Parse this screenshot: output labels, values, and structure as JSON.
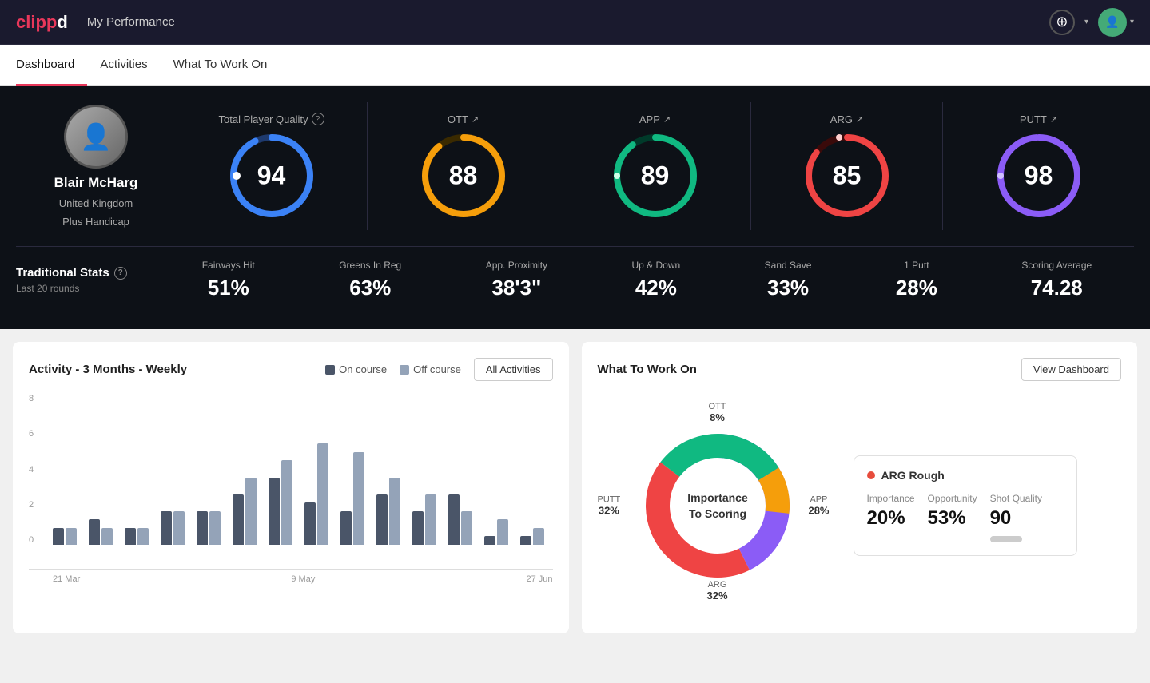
{
  "header": {
    "logo": "clippd",
    "title": "My Performance",
    "add_button_label": "+",
    "avatar_chevron": "▾"
  },
  "tabs": [
    {
      "id": "dashboard",
      "label": "Dashboard",
      "active": true
    },
    {
      "id": "activities",
      "label": "Activities",
      "active": false
    },
    {
      "id": "what-to-work-on",
      "label": "What To Work On",
      "active": false
    }
  ],
  "player": {
    "name": "Blair McHarg",
    "country": "United Kingdom",
    "handicap": "Plus Handicap"
  },
  "total_quality": {
    "label": "Total Player Quality",
    "score": 94,
    "color": "#3b82f6",
    "track_color": "#1e3a6e"
  },
  "category_scores": [
    {
      "id": "ott",
      "label": "OTT",
      "score": 88,
      "color": "#f59e0b",
      "track_color": "#3a2a00"
    },
    {
      "id": "app",
      "label": "APP",
      "score": 89,
      "color": "#10b981",
      "track_color": "#003a2a"
    },
    {
      "id": "arg",
      "label": "ARG",
      "score": 85,
      "color": "#ef4444",
      "track_color": "#3a0a0a"
    },
    {
      "id": "putt",
      "label": "PUTT",
      "score": 98,
      "color": "#8b5cf6",
      "track_color": "#1a0a3a"
    }
  ],
  "traditional_stats": {
    "title": "Traditional Stats",
    "subtitle": "Last 20 rounds",
    "items": [
      {
        "name": "Fairways Hit",
        "value": "51%"
      },
      {
        "name": "Greens In Reg",
        "value": "63%"
      },
      {
        "name": "App. Proximity",
        "value": "38'3\""
      },
      {
        "name": "Up & Down",
        "value": "42%"
      },
      {
        "name": "Sand Save",
        "value": "33%"
      },
      {
        "name": "1 Putt",
        "value": "28%"
      },
      {
        "name": "Scoring Average",
        "value": "74.28"
      }
    ]
  },
  "activity_chart": {
    "title": "Activity - 3 Months - Weekly",
    "legend": [
      {
        "label": "On course",
        "color": "#4a5568"
      },
      {
        "label": "Off course",
        "color": "#94a3b8"
      }
    ],
    "all_activities_btn": "All Activities",
    "y_labels": [
      "0",
      "2",
      "4",
      "6",
      "8"
    ],
    "x_labels": [
      "21 Mar",
      "9 May",
      "27 Jun"
    ],
    "bars": [
      {
        "on": 1,
        "off": 1
      },
      {
        "on": 1.5,
        "off": 1
      },
      {
        "on": 1,
        "off": 1
      },
      {
        "on": 2,
        "off": 2
      },
      {
        "on": 2,
        "off": 2
      },
      {
        "on": 3,
        "off": 4
      },
      {
        "on": 4,
        "off": 5
      },
      {
        "on": 2.5,
        "off": 6
      },
      {
        "on": 2,
        "off": 5.5
      },
      {
        "on": 3,
        "off": 4
      },
      {
        "on": 2,
        "off": 3
      },
      {
        "on": 3,
        "off": 2
      },
      {
        "on": 0.5,
        "off": 1.5
      },
      {
        "on": 0.5,
        "off": 1
      }
    ],
    "max_val": 9
  },
  "what_to_work_on": {
    "title": "What To Work On",
    "view_dashboard_btn": "View Dashboard",
    "center_label_line1": "Importance",
    "center_label_line2": "To Scoring",
    "segments": [
      {
        "id": "ott",
        "label": "OTT",
        "pct": "8%",
        "color": "#f59e0b"
      },
      {
        "id": "app",
        "label": "APP",
        "pct": "28%",
        "color": "#10b981"
      },
      {
        "id": "arg",
        "label": "ARG",
        "pct": "32%",
        "color": "#ef4444"
      },
      {
        "id": "putt",
        "label": "PUTT",
        "pct": "32%",
        "color": "#8b5cf6"
      }
    ],
    "info_card": {
      "title": "ARG Rough",
      "dot_color": "#e74c3c",
      "stats": [
        {
          "label": "Importance",
          "value": "20%"
        },
        {
          "label": "Opportunity",
          "value": "53%"
        },
        {
          "label": "Shot Quality",
          "value": "90"
        }
      ]
    }
  }
}
